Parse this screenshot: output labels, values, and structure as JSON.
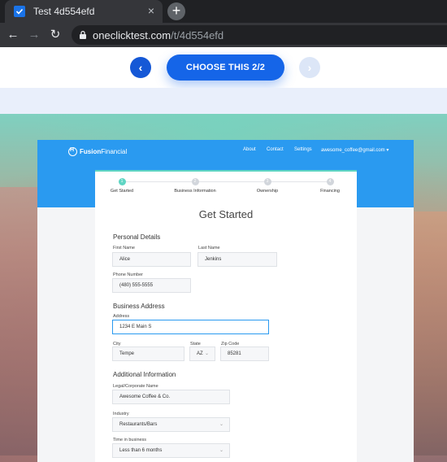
{
  "browser": {
    "tab_title": "Test 4d554efd",
    "tab_close": "×",
    "new_tab": "+",
    "url_host": "oneclicktest.com",
    "url_path": "/t/4d554efd",
    "back": "←",
    "forward": "→",
    "reload": "↻"
  },
  "stage": {
    "prev": "‹",
    "choose_label": "CHOOSE THIS 2/2",
    "next": "›"
  },
  "app": {
    "brand_bold": "Fusion",
    "brand_rest": "Financial",
    "nav": {
      "about": "About",
      "contact": "Contact",
      "settings": "Settings",
      "user": "awesome_coffee@gmail.com"
    },
    "steps": [
      {
        "num": "1",
        "label": "Get Started"
      },
      {
        "num": "2",
        "label": "Business Information"
      },
      {
        "num": "3",
        "label": "Ownership"
      },
      {
        "num": "4",
        "label": "Financing"
      }
    ],
    "title": "Get Started",
    "personal": {
      "heading": "Personal Details",
      "first_name_label": "First Name",
      "first_name": "Alice",
      "last_name_label": "Last Name",
      "last_name": "Jenkins",
      "phone_label": "Phone Number",
      "phone": "(480) 555-5555"
    },
    "business": {
      "heading": "Business Address",
      "address_label": "Address",
      "address": "1234 E Main S",
      "city_label": "City",
      "city": "Tempe",
      "state_label": "State",
      "state": "AZ",
      "zip_label": "Zip Code",
      "zip": "85281"
    },
    "additional": {
      "heading": "Additional Information",
      "legal_label": "Legal/Corporate Name",
      "legal": "Awesome Coffee & Co.",
      "industry_label": "Industry",
      "industry": "Restaurants/Bars",
      "time_label": "Time in business",
      "time": "Less than 6 months"
    }
  },
  "colors": {
    "accent": "#1565e8",
    "header": "#2a9af0",
    "step_active": "#5fd5c3"
  }
}
